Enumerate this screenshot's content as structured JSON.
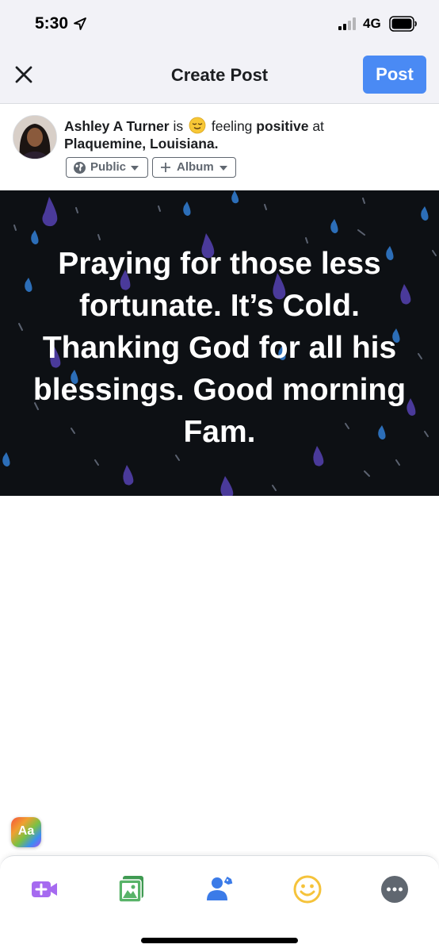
{
  "status_bar": {
    "time": "5:30",
    "network": "4G"
  },
  "header": {
    "title": "Create Post",
    "post_label": "Post"
  },
  "author": {
    "name": "Ashley A Turner",
    "is_text": "is",
    "feeling_text": "feeling",
    "feeling": "positive",
    "at_text": "at",
    "location": "Plaquemine, Louisiana.",
    "audience_label": "Public",
    "album_label": "Album"
  },
  "post": {
    "text": "Praying for those less fortunate. It’s Cold. Thanking God for all his blessings. Good morning Fam."
  },
  "text_style_button": {
    "label": "Aa"
  },
  "colors": {
    "accent": "#4a8af4",
    "post_background": "#0d1014",
    "video_icon": "#a66af0",
    "photo_icon": "#58b368",
    "tag_icon": "#3b7be8",
    "feeling_icon": "#f5c33b",
    "more_icon": "#606770"
  },
  "toolbar_icons": [
    "live-video-icon",
    "photo-icon",
    "tag-people-icon",
    "feeling-icon",
    "more-icon"
  ]
}
